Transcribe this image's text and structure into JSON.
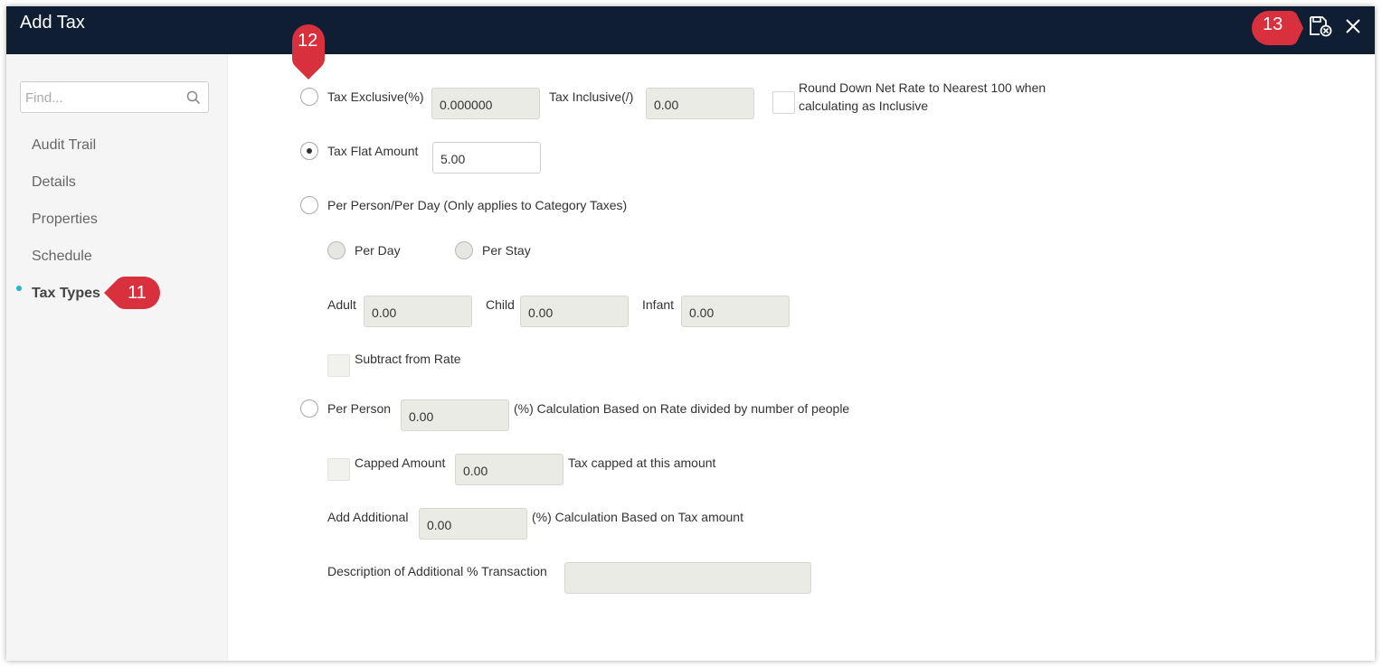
{
  "window": {
    "title": "Add Tax"
  },
  "sidebar": {
    "search_placeholder": "Find...",
    "items": [
      {
        "label": "Audit Trail"
      },
      {
        "label": "Details"
      },
      {
        "label": "Properties"
      },
      {
        "label": "Schedule"
      },
      {
        "label": "Tax Types",
        "active": true
      }
    ]
  },
  "form": {
    "tax_exclusive": {
      "label": "Tax Exclusive(%)",
      "value": "0.000000",
      "selected": false
    },
    "tax_inclusive": {
      "label": "Tax Inclusive(/)",
      "value": "0.00"
    },
    "round_down": {
      "label_line1": "Round Down Net Rate to Nearest 100 when",
      "label_line2": "calculating as Inclusive",
      "checked": false
    },
    "tax_flat_amount": {
      "label": "Tax Flat Amount",
      "value": "5.00",
      "selected": true
    },
    "per_person_per_day": {
      "label": "Per Person/Per Day (Only applies to Category Taxes)",
      "selected": false
    },
    "per_day": {
      "label": "Per Day"
    },
    "per_stay": {
      "label": "Per Stay"
    },
    "adult": {
      "label": "Adult",
      "value": "0.00"
    },
    "child": {
      "label": "Child",
      "value": "0.00"
    },
    "infant": {
      "label": "Infant",
      "value": "0.00"
    },
    "subtract_from_rate": {
      "label": "Subtract from Rate"
    },
    "per_person": {
      "label": "Per Person",
      "value": "0.00",
      "note": "(%) Calculation Based on Rate divided by number of people",
      "selected": false
    },
    "capped_amount": {
      "label": "Capped Amount",
      "value": "0.00",
      "note": "Tax capped at this amount"
    },
    "add_additional": {
      "label": "Add Additional",
      "value": "0.00",
      "note": "(%) Calculation Based on Tax amount"
    },
    "description_additional": {
      "label": "Description of Additional % Transaction",
      "value": ""
    }
  },
  "annotations": {
    "callout_11": "11",
    "callout_12": "12",
    "callout_13": "13",
    "color": "#d9303e"
  },
  "colors": {
    "titlebar": "#0f1e33",
    "active_dot": "#24b7c9",
    "field_disabled": "#ebebe6"
  },
  "icons": {
    "search": "search-icon",
    "save_close": "save-close-icon",
    "close": "close-icon"
  }
}
